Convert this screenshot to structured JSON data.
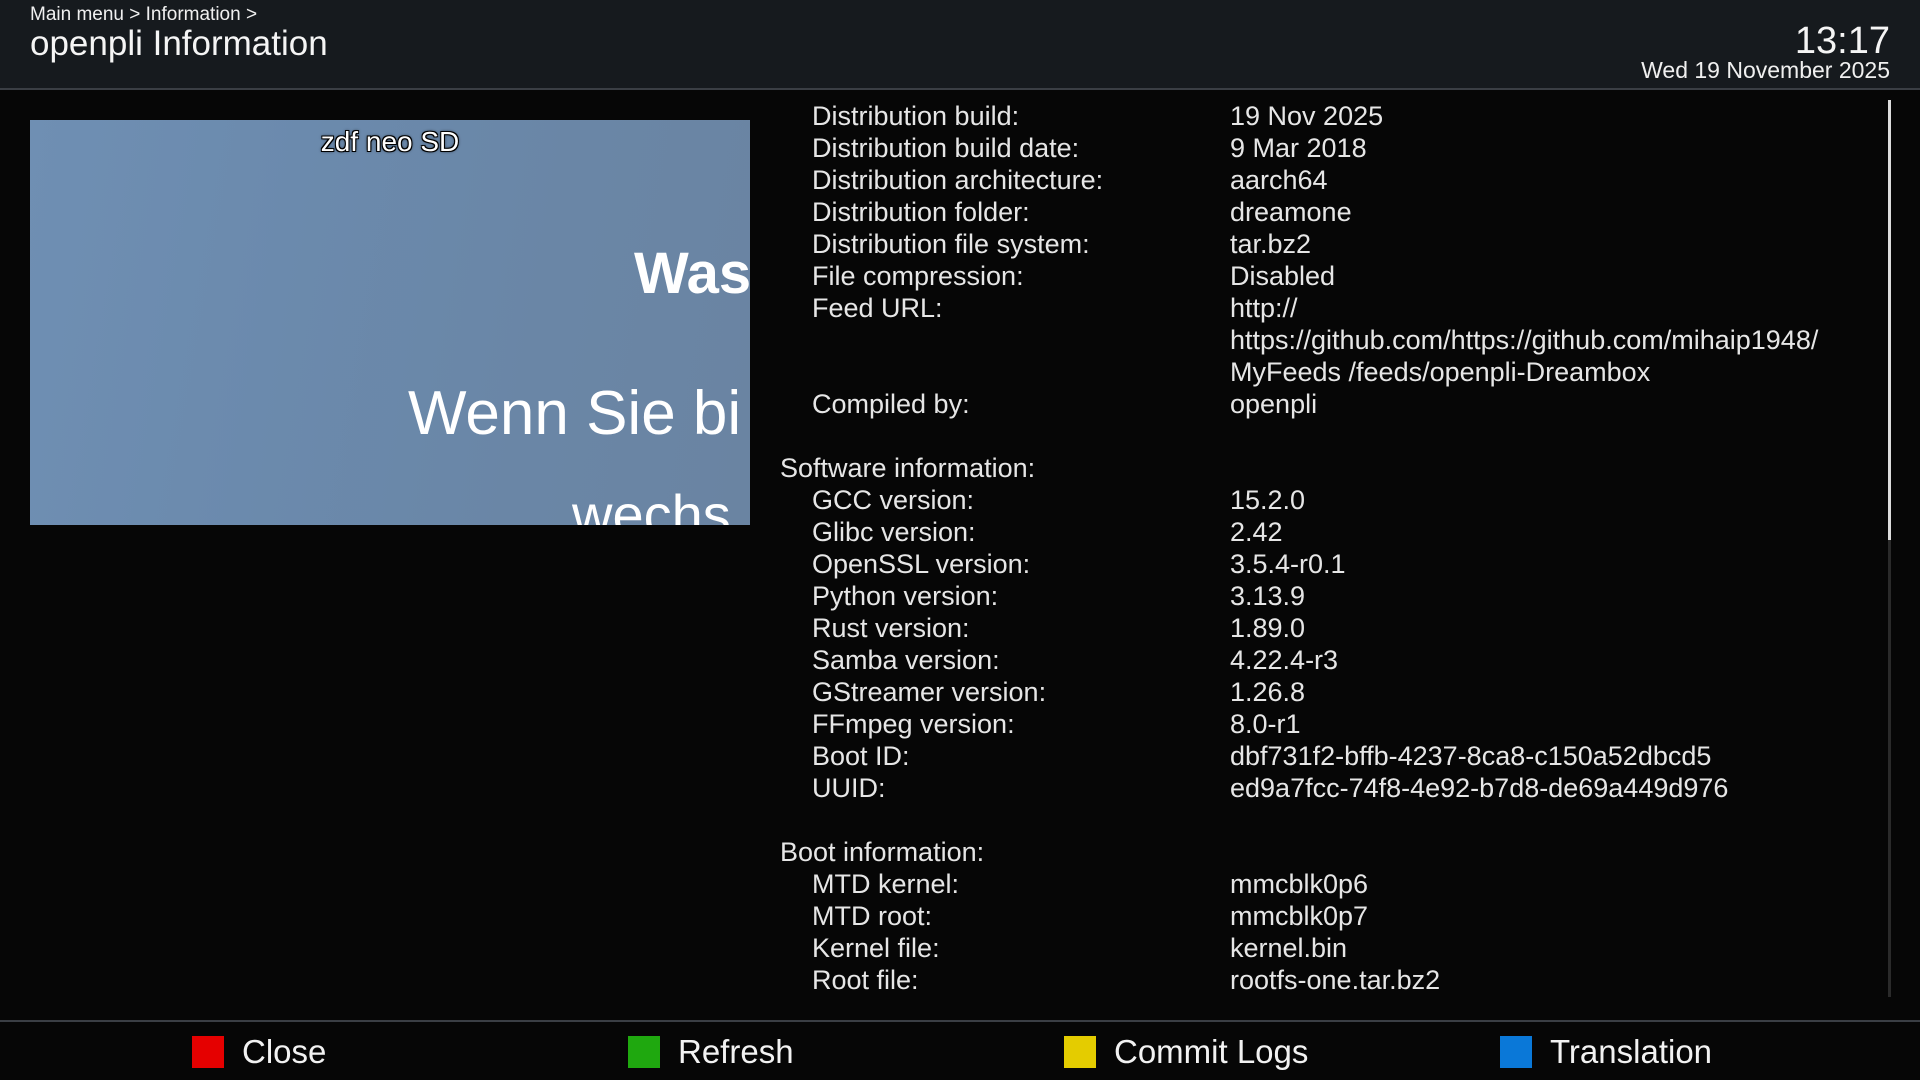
{
  "header": {
    "breadcrumb": "Main menu > Information >",
    "title": "openpli Information",
    "time": "13:17",
    "date": "Wed 19 November 2025"
  },
  "tv_preview": {
    "channel": "zdf neo SD",
    "overlay_lines": [
      "Was",
      "Wenn Sie bi",
      "wechs"
    ],
    "background_color": "#6b8aad"
  },
  "info": {
    "distribution_rows": [
      {
        "label": "Distribution build:",
        "value": "19 Nov 2025"
      },
      {
        "label": "Distribution build date:",
        "value": "9 Mar 2018"
      },
      {
        "label": "Distribution architecture:",
        "value": "aarch64"
      },
      {
        "label": "Distribution folder:",
        "value": "dreamone"
      },
      {
        "label": "Distribution file system:",
        "value": "tar.bz2"
      },
      {
        "label": "File compression:",
        "value": "Disabled"
      },
      {
        "label": "Feed URL:",
        "value": "http://"
      },
      {
        "label": "",
        "value": "https://github.com/https://github.com/mihaip1948/"
      },
      {
        "label": "",
        "value": "MyFeeds /feeds/openpli-Dreambox"
      },
      {
        "label": "Compiled by:",
        "value": "openpli"
      }
    ],
    "software_title": "Software information:",
    "software_rows": [
      {
        "label": "GCC version:",
        "value": "15.2.0"
      },
      {
        "label": "Glibc version:",
        "value": "2.42"
      },
      {
        "label": "OpenSSL version:",
        "value": "3.5.4-r0.1"
      },
      {
        "label": "Python version:",
        "value": "3.13.9"
      },
      {
        "label": "Rust version:",
        "value": "1.89.0"
      },
      {
        "label": "Samba version:",
        "value": "4.22.4-r3"
      },
      {
        "label": "GStreamer version:",
        "value": "1.26.8"
      },
      {
        "label": "FFmpeg version:",
        "value": "8.0-r1"
      },
      {
        "label": "Boot ID:",
        "value": "dbf731f2-bffb-4237-8ca8-c150a52dbcd5"
      },
      {
        "label": "UUID:",
        "value": "ed9a7fcc-74f8-4e92-b7d8-de69a449d976"
      }
    ],
    "boot_title": "Boot information:",
    "boot_rows": [
      {
        "label": "MTD kernel:",
        "value": "mmcblk0p6"
      },
      {
        "label": "MTD root:",
        "value": "mmcblk0p7"
      },
      {
        "label": "Kernel file:",
        "value": "kernel.bin"
      },
      {
        "label": "Root file:",
        "value": "rootfs-one.tar.bz2"
      }
    ]
  },
  "scroll": {
    "visible_fraction": 0.49
  },
  "buttons": {
    "red": {
      "label": "Close",
      "color": "#e50000"
    },
    "green": {
      "label": "Refresh",
      "color": "#1fa80f"
    },
    "yellow": {
      "label": "Commit Logs",
      "color": "#e4cc00"
    },
    "blue": {
      "label": "Translation",
      "color": "#0a78d8"
    }
  }
}
